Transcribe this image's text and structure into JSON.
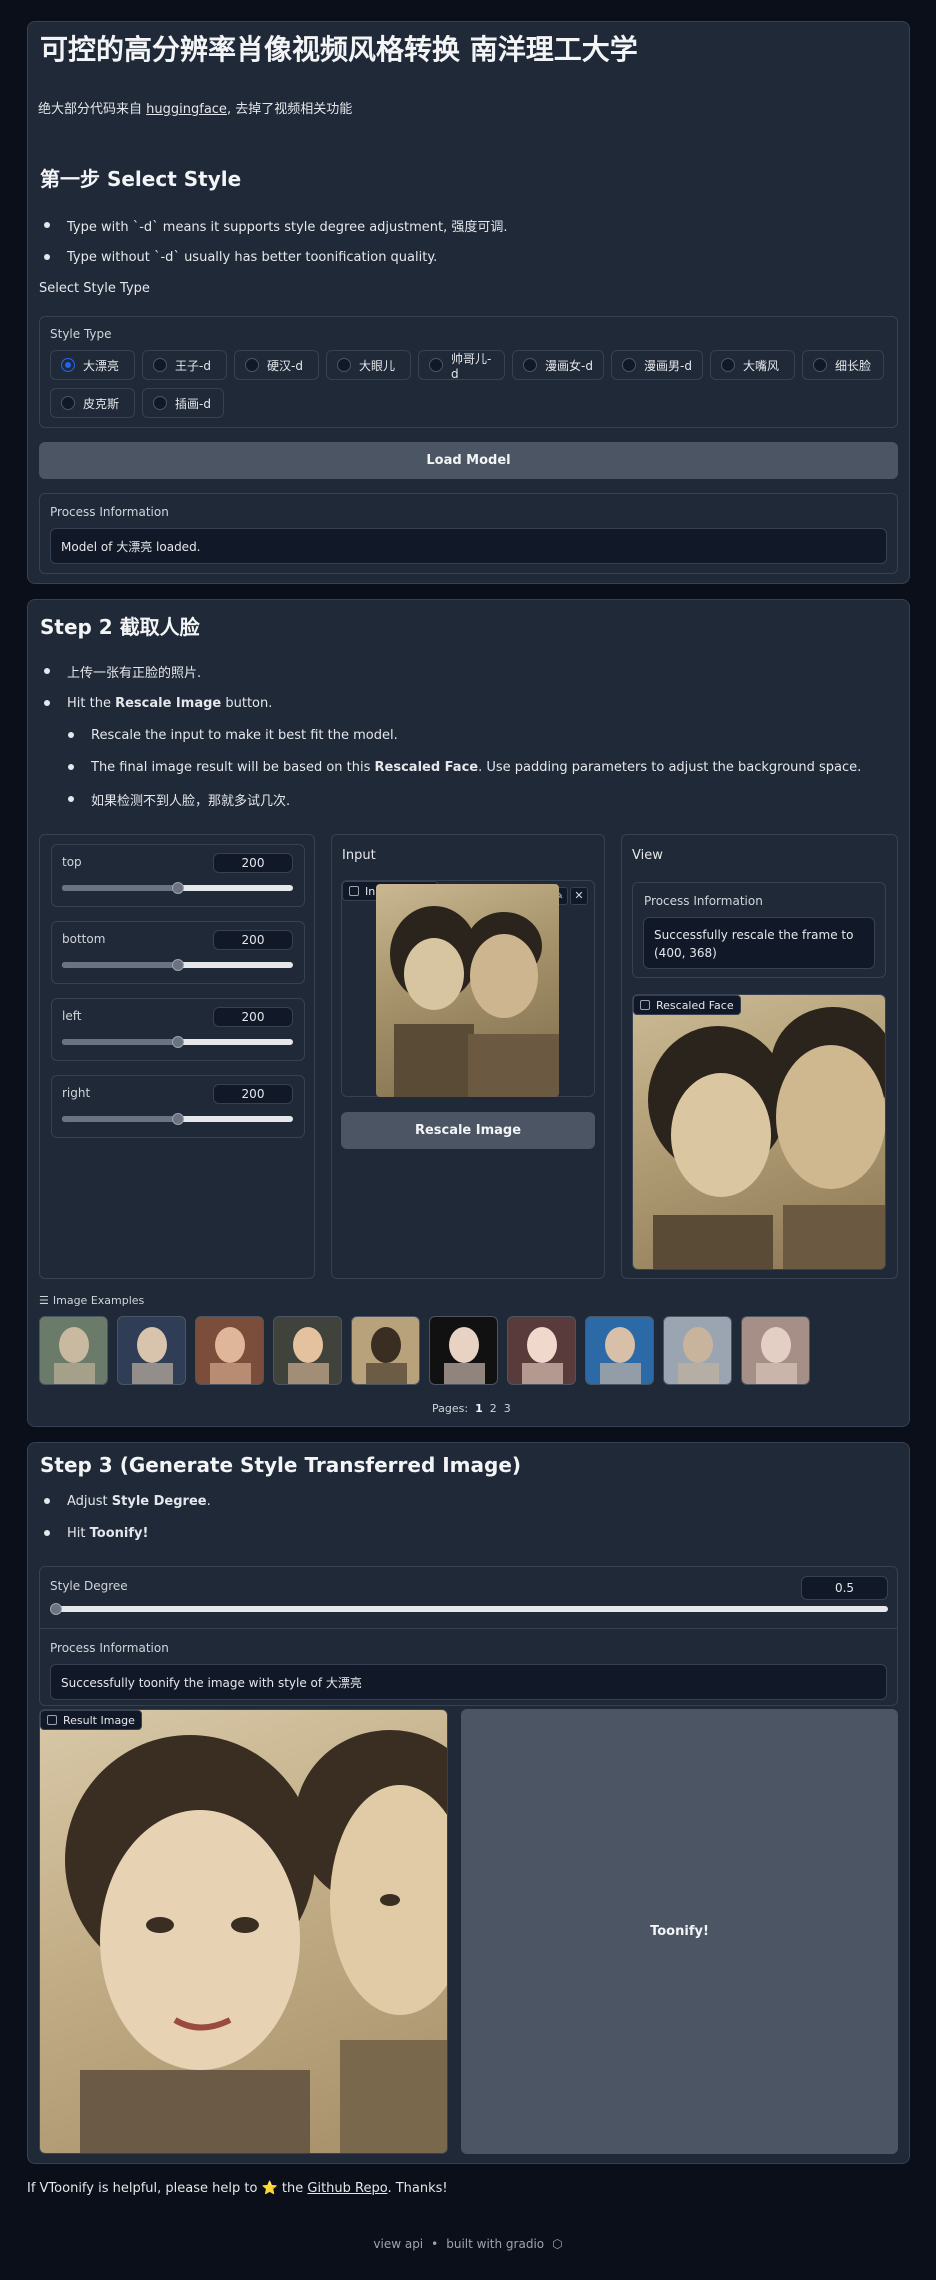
{
  "header": {
    "title": "可控的高分辨率肖像视频风格转换 南洋理工大学",
    "desc_prefix": "绝大部分代码来自",
    "desc_link": "huggingface",
    "desc_suffix": ", 去掉了视频相关功能"
  },
  "step1": {
    "title": "第一步 Select Style",
    "bullets": [
      "Type with `-d` means it supports style degree adjustment, 强度可调.",
      "Type without `-d` usually has better toonification quality."
    ],
    "select_label": "Select Style Type",
    "style_type_label": "Style Type",
    "styles": [
      "大漂亮",
      "王子-d",
      "硬汉-d",
      "大眼儿",
      "帅哥儿-d",
      "漫画女-d",
      "漫画男-d",
      "大嘴风",
      "细长脸",
      "皮克斯",
      "插画-d"
    ],
    "selected": "大漂亮",
    "load_button": "Load Model",
    "process_label": "Process Information",
    "process_value": "Model of 大漂亮 loaded."
  },
  "step2": {
    "title": "Step 2 截取人脸",
    "bullet1": "上传一张有正脸的照片.",
    "bullet2_prefix": "Hit the ",
    "bullet2_bold": "Rescale Image",
    "bullet2_suffix": " button.",
    "sub1": "Rescale the input to make it best fit the model.",
    "sub2_prefix": "The final image result will be based on this ",
    "sub2_bold": "Rescaled Face",
    "sub2_suffix": ". Use padding parameters to adjust the background space.",
    "sub3": "如果检测不到人脸，那就多试几次.",
    "sliders": [
      {
        "label": "top",
        "value": "200",
        "fraction": 0.5
      },
      {
        "label": "bottom",
        "value": "200",
        "fraction": 0.5
      },
      {
        "label": "left",
        "value": "200",
        "fraction": 0.5
      },
      {
        "label": "right",
        "value": "200",
        "fraction": 0.5
      }
    ],
    "input_title": "Input",
    "input_image_label": "Input Image",
    "rescale_button": "Rescale Image",
    "view_title": "View",
    "view_process_label": "Process Information",
    "view_process_value": "Successfully rescale the frame to (400, 368)",
    "rescaled_face_label": "Rescaled Face",
    "examples_label": "Image Examples",
    "pages_label": "Pages:",
    "pages": [
      "1",
      "2",
      "3"
    ],
    "current_page": "1"
  },
  "step3": {
    "title": "Step 3 (Generate Style Transferred Image)",
    "bullet1_prefix": "Adjust ",
    "bullet1_bold": "Style Degree",
    "bullet1_suffix": ".",
    "bullet2_prefix": "Hit ",
    "bullet2_bold": "Toonify!",
    "degree_label": "Style Degree",
    "degree_value": "0.5",
    "degree_fraction": 0.0,
    "process_label": "Process Information",
    "process_value": "Successfully toonify the image with style of 大漂亮",
    "result_label": "Result Image",
    "toonify_button": "Toonify!"
  },
  "footer": {
    "prefix": "If VToonify is helpful, please help to",
    "star": "⭐",
    "middle": "the",
    "link": "Github Repo",
    "suffix": ". Thanks!",
    "view_api": "view api",
    "sep": "•",
    "built_with": "built with gradio"
  },
  "colors": {
    "background": "#0b0f19",
    "panel": "#1f2937",
    "accent": "#2563eb",
    "button": "#4b5563"
  }
}
